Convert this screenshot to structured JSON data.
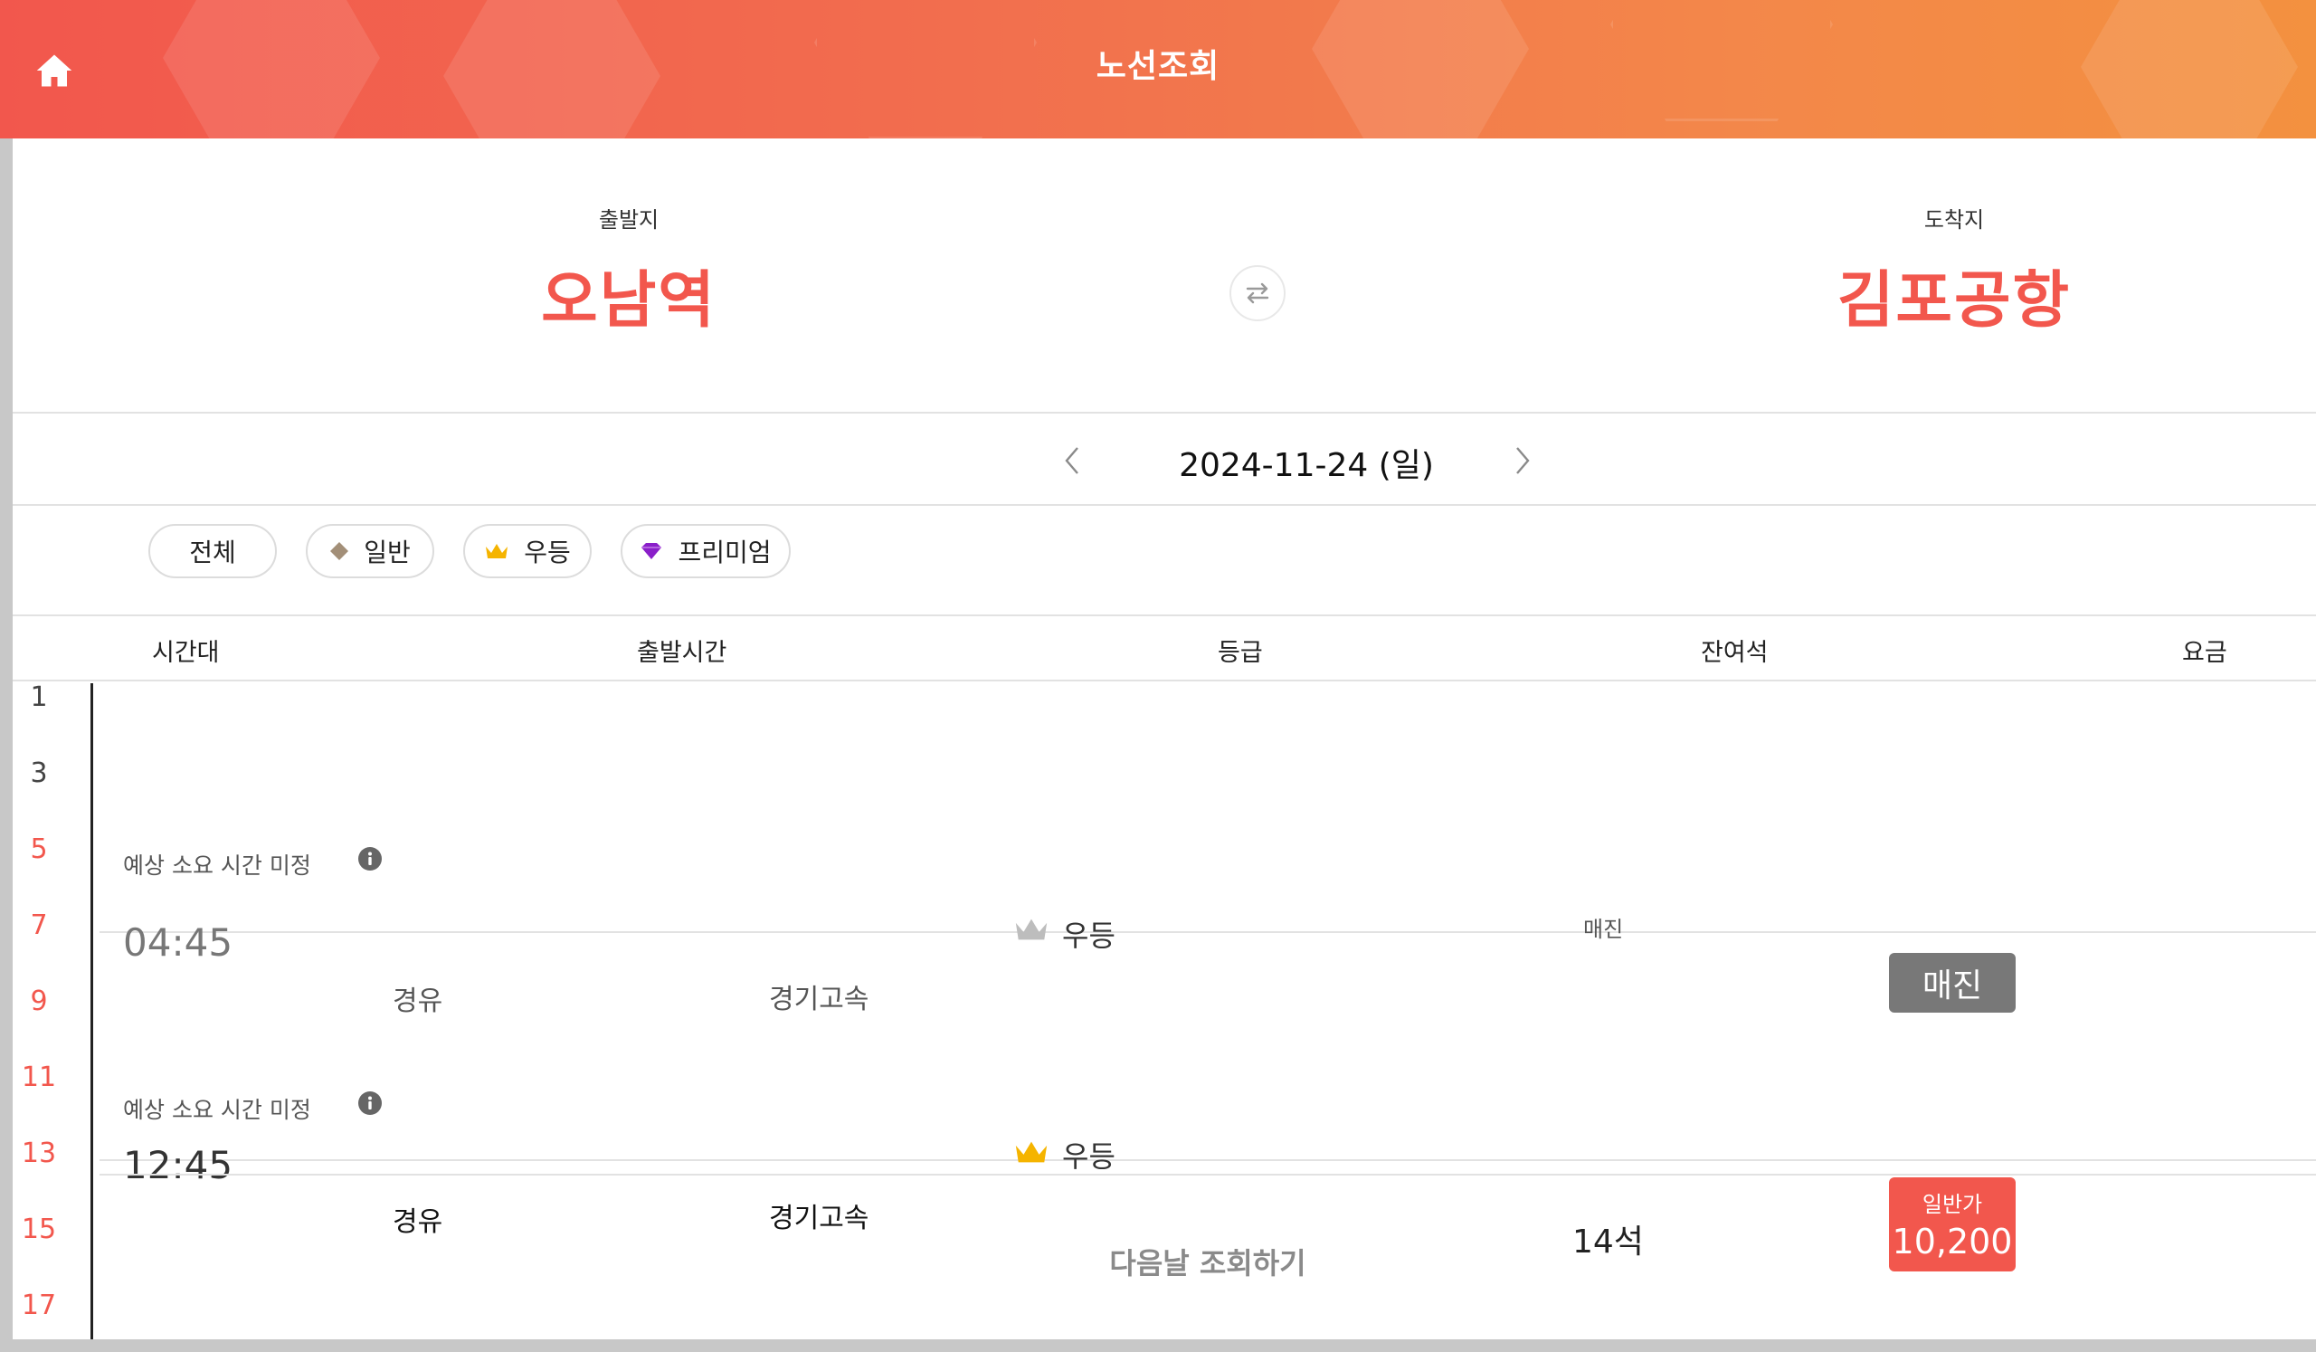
{
  "header": {
    "title": "노선조회",
    "home_icon": "home-icon"
  },
  "route": {
    "departure_label": "출발지",
    "departure_name": "오남역",
    "arrival_label": "도착지",
    "arrival_name": "김포공항",
    "swap_icon": "swap-icon"
  },
  "date": {
    "value": "2024-11-24 (일)"
  },
  "filters": [
    {
      "label": "전체"
    },
    {
      "label": "일반",
      "icon": "diamond-icon"
    },
    {
      "label": "우등",
      "icon": "crown-icon"
    },
    {
      "label": "프리미엄",
      "icon": "gem-icon"
    }
  ],
  "columns": [
    "시간대",
    "출발시간",
    "등급",
    "잔여석",
    "요금"
  ],
  "timeline": [
    "1",
    "3",
    "5",
    "7",
    "9",
    "11",
    "13",
    "15",
    "17"
  ],
  "trips": [
    {
      "duration": "예상 소요 시간 미정",
      "time": "04:45",
      "via": "경유",
      "road": "경기고속",
      "grade": "우등",
      "seats_label": "매진",
      "status": "매진"
    },
    {
      "duration": "예상 소요 시간 미정",
      "time": "12:45",
      "via": "경유",
      "road": "경기고속",
      "grade": "우등",
      "seats": "14석",
      "fare_label": "일반가",
      "fare": "10,200"
    }
  ],
  "next_day": "다음날 조회하기",
  "colors": {
    "accent": "#f2574d",
    "header_start": "#f2574d",
    "header_end": "#f3913f",
    "crown_gold": "#f5b400",
    "crown_disabled": "#bdbdbd",
    "sold_out": "#787878",
    "premium_purple": "#8a1fc9",
    "diamond_tan": "#a38f78"
  }
}
